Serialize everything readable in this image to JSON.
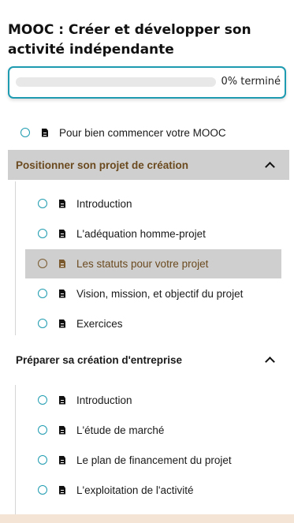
{
  "course": {
    "title": "MOOC : Créer et développer son activité indépendante",
    "progress_text": "0% terminé",
    "progress_value": 0
  },
  "intro_item": {
    "label": "Pour bien commencer votre MOOC"
  },
  "sections": [
    {
      "title": "Positionner son projet de création",
      "items": [
        {
          "label": "Introduction"
        },
        {
          "label": "L'adéquation homme-projet"
        },
        {
          "label": "Les statuts pour votre projet"
        },
        {
          "label": "Vision, mission, et objectif du projet"
        },
        {
          "label": "Exercices"
        }
      ]
    },
    {
      "title": "Préparer sa création d'entreprise",
      "items": [
        {
          "label": "Introduction"
        },
        {
          "label": "L'étude de marché"
        },
        {
          "label": "Le plan de financement du projet"
        },
        {
          "label": "L'exploitation de l'activité"
        }
      ]
    }
  ],
  "colors": {
    "accent": "#1e9bb0",
    "active_text": "#6b4a1f",
    "active_bg": "#cfcfcf"
  },
  "icons": {
    "status": "circle-icon",
    "lesson": "document-icon",
    "collapse": "chevron-up-icon"
  }
}
